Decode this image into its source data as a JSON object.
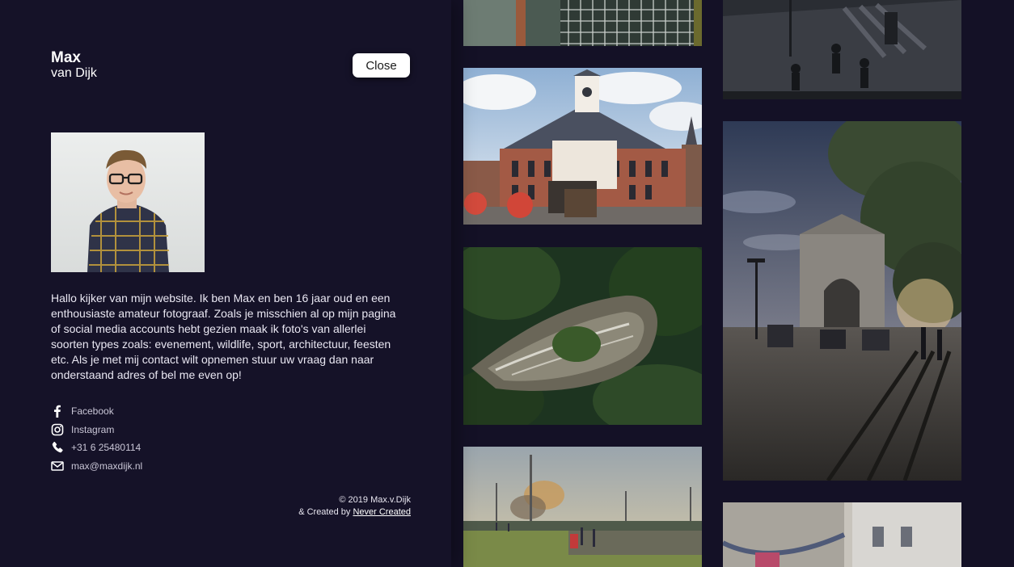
{
  "profile": {
    "first_name": "Max",
    "last_name": "van Dijk",
    "bio": "Hallo kijker van mijn website. Ik ben Max en ben 16 jaar oud en een enthousiaste amateur fotograaf. Zoals je misschien al op mijn pagina of social media accounts hebt gezien maak ik foto's van allerlei soorten types zoals: evenement, wildlife, sport, architectuur, feesten etc. Als je met mij contact wilt opnemen stuur uw vraag dan naar onderstaand adres of bel me even op!"
  },
  "close_label": "Close",
  "contacts": [
    {
      "icon": "facebook-icon",
      "label": "Facebook"
    },
    {
      "icon": "instagram-icon",
      "label": "Instagram"
    },
    {
      "icon": "phone-icon",
      "label": "+31 6 25480114"
    },
    {
      "icon": "mail-icon",
      "label": "max@maxdijk.nl"
    }
  ],
  "footer": {
    "copyright": "© 2019 Max.v.Dijk",
    "created_prefix": "& Created by",
    "created_link": "Never Created"
  },
  "colors": {
    "panel_bg": "#151228",
    "gallery_bg": "#141126",
    "button_bg": "#ffffff"
  }
}
